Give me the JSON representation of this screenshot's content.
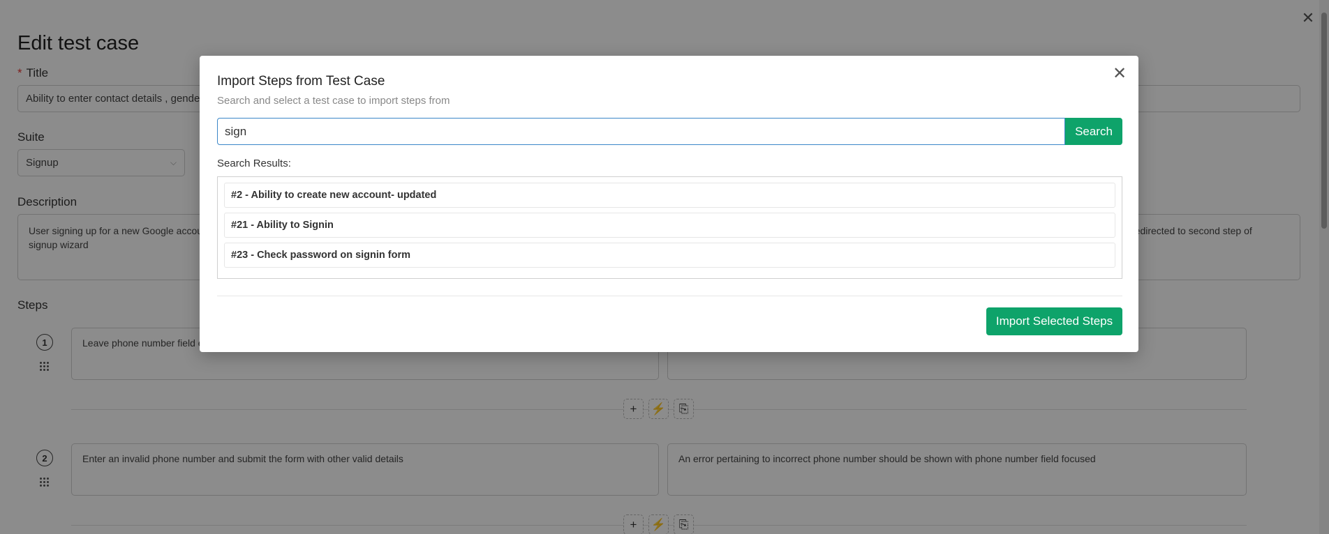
{
  "page": {
    "title": "Edit test case",
    "close_glyph": "✕",
    "title_label": "Title",
    "required_mark": "*",
    "title_value": "Ability to enter contact details , gender a",
    "suite_label": "Suite",
    "suite_value": "Signup",
    "description_label": "Description",
    "description_left": "User signing up for a new Google accou\nsignup wizard",
    "description_right": "redirected to second step of",
    "steps_label": "Steps",
    "steps": [
      {
        "number": "1",
        "action": "Leave phone number field e",
        "expected": ""
      },
      {
        "number": "2",
        "action": "Enter an invalid phone number and submit the form with other valid details",
        "expected": "An error pertaining to incorrect phone number should be shown with phone number field focused"
      }
    ],
    "toolbar_icons": {
      "add": "+",
      "generate": "⚡",
      "copy": "⎘"
    }
  },
  "modal": {
    "title": "Import Steps from Test Case",
    "subtitle": "Search and select a test case to import steps from",
    "search_value": "sign",
    "search_button": "Search",
    "results_label": "Search Results:",
    "results": [
      "#2 - Ability to create new account- updated",
      "#21 - Ability to Signin",
      "#23 - Check password on signin form"
    ],
    "import_button": "Import Selected Steps",
    "close_glyph": "✕"
  }
}
